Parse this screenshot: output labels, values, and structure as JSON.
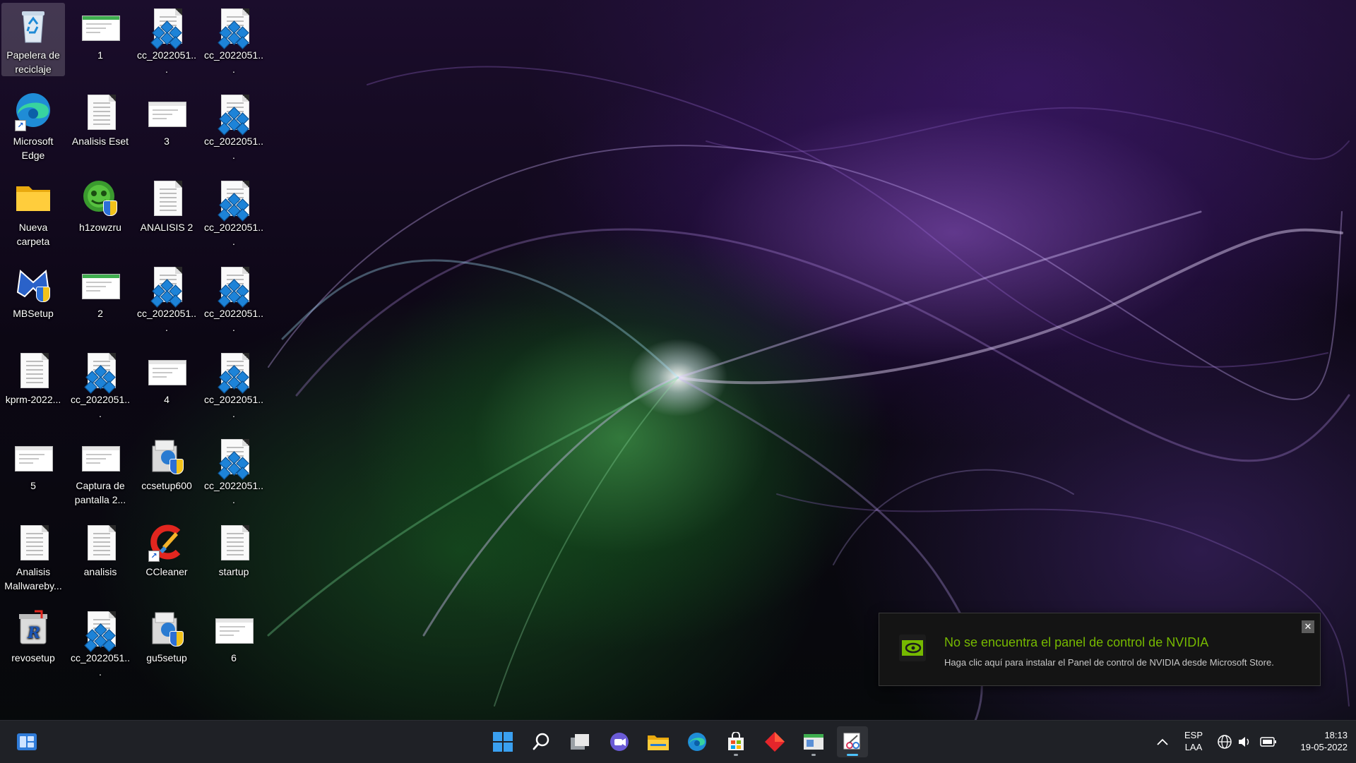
{
  "desktop": {
    "icons": [
      {
        "label": "Papelera de reciclaje",
        "type": "recycle-bin"
      },
      {
        "label": "1",
        "type": "image-green"
      },
      {
        "label": "cc_2022051...",
        "type": "registry"
      },
      {
        "label": "cc_2022051...",
        "type": "registry"
      },
      {
        "label": "Microsoft Edge",
        "type": "edge"
      },
      {
        "label": "Analisis Eset",
        "type": "text"
      },
      {
        "label": "3",
        "type": "image"
      },
      {
        "label": "cc_2022051...",
        "type": "registry"
      },
      {
        "label": "Nueva carpeta",
        "type": "folder"
      },
      {
        "label": "h1zowzru",
        "type": "drweb"
      },
      {
        "label": "ANALISIS 2",
        "type": "text"
      },
      {
        "label": "cc_2022051...",
        "type": "registry"
      },
      {
        "label": "MBSetup",
        "type": "malwarebytes"
      },
      {
        "label": "2",
        "type": "image-green"
      },
      {
        "label": "cc_2022051...",
        "type": "registry"
      },
      {
        "label": "cc_2022051...",
        "type": "registry"
      },
      {
        "label": "kprm-2022...",
        "type": "text"
      },
      {
        "label": "cc_2022051...",
        "type": "registry"
      },
      {
        "label": "4",
        "type": "image"
      },
      {
        "label": "cc_2022051...",
        "type": "registry"
      },
      {
        "label": "5",
        "type": "image"
      },
      {
        "label": "Captura de pantalla 2...",
        "type": "image"
      },
      {
        "label": "ccsetup600",
        "type": "installer"
      },
      {
        "label": "cc_2022051...",
        "type": "registry"
      },
      {
        "label": "Analisis Mallwareby...",
        "type": "text"
      },
      {
        "label": "analisis",
        "type": "text"
      },
      {
        "label": "CCleaner",
        "type": "ccleaner"
      },
      {
        "label": "startup",
        "type": "text"
      },
      {
        "label": "revosetup",
        "type": "revo"
      },
      {
        "label": "cc_2022051...",
        "type": "registry"
      },
      {
        "label": "gu5setup",
        "type": "installer"
      },
      {
        "label": "6",
        "type": "image"
      }
    ]
  },
  "toast": {
    "title": "No se encuentra el panel de control de NVIDIA",
    "body": "Haga clic aquí para instalar el Panel de control de NVIDIA desde Microsoft Store.",
    "close_icon": "close-icon",
    "logo_icon": "nvidia-icon",
    "title_color": "#76b900"
  },
  "taskbar": {
    "widgets_icon": "widgets-icon",
    "pinned": [
      "windows-start-icon",
      "search-icon",
      "task-view-icon",
      "chat-icon",
      "file-explorer-icon",
      "edge-icon",
      "store-icon",
      "red-app-icon",
      "app-window-icon",
      "snipping-tool-icon"
    ],
    "tray": {
      "language_line1": "ESP",
      "language_line2": "LAA",
      "time": "18:13",
      "date": "19-05-2022"
    }
  }
}
